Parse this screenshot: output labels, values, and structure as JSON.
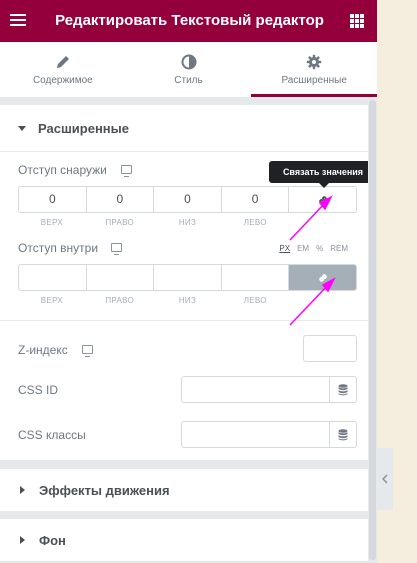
{
  "header": {
    "title": "Редактировать Текстовый редактор",
    "bg_color": "#93003c"
  },
  "tabs": [
    {
      "label": "Содержимое",
      "icon": "pencil-icon"
    },
    {
      "label": "Стиль",
      "icon": "half-circle-icon"
    },
    {
      "label": "Расширенные",
      "icon": "gear-icon",
      "active": true
    }
  ],
  "advanced": {
    "title": "Расширенные",
    "margin": {
      "label": "Отступ снаружи",
      "values": [
        "0",
        "0",
        "0",
        "0"
      ],
      "sides": [
        "ВЕРХ",
        "ПРАВО",
        "НИЗ",
        "ЛЕВО"
      ],
      "linked": false
    },
    "tooltip": "Связать значения",
    "padding": {
      "label": "Отступ внутри",
      "values": [
        "",
        "",
        "",
        ""
      ],
      "sides": [
        "ВЕРХ",
        "ПРАВО",
        "НИЗ",
        "ЛЕВО"
      ],
      "linked": true,
      "units": [
        "PX",
        "EM",
        "%",
        "REM"
      ],
      "selected_unit": "PX"
    },
    "z_index": {
      "label": "Z-индекс",
      "value": ""
    },
    "css_id": {
      "label": "CSS ID",
      "value": ""
    },
    "css_classes": {
      "label": "CSS классы",
      "value": ""
    }
  },
  "sections": [
    {
      "title": "Эффекты движения"
    },
    {
      "title": "Фон"
    }
  ],
  "colors": {
    "accent": "#93003c",
    "annotation_arrow": "#ff00ff",
    "linked_bg": "#a4afb7"
  }
}
